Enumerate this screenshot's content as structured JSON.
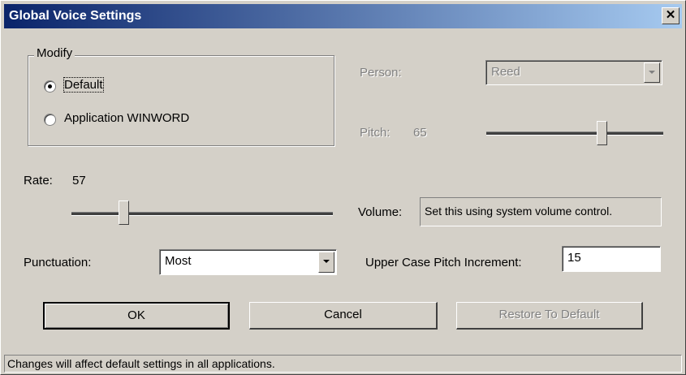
{
  "window": {
    "title": "Global Voice Settings",
    "close_glyph": "✕"
  },
  "modify": {
    "legend": "Modify",
    "options": [
      {
        "label": "Default",
        "selected": true
      },
      {
        "label": "Application WINWORD",
        "selected": false
      }
    ]
  },
  "person": {
    "label": "Person:",
    "value": "Reed",
    "enabled": false
  },
  "pitch": {
    "label": "Pitch:",
    "value": "65",
    "enabled": false,
    "level": 0.65
  },
  "rate": {
    "label": "Rate:",
    "value": "57",
    "level": 0.2
  },
  "volume": {
    "label": "Volume:",
    "value": "Set this using system volume control."
  },
  "punctuation": {
    "label": "Punctuation:",
    "value": "Most"
  },
  "upper_case": {
    "label": "Upper Case Pitch Increment:",
    "value": "15"
  },
  "buttons": {
    "ok": "OK",
    "cancel": "Cancel",
    "restore": "Restore To Default"
  },
  "status": {
    "text": "Changes will affect default settings in all applications."
  },
  "colors": {
    "title_bar_start": "#0a246a",
    "title_bar_end": "#a6caf0",
    "dialog_bg": "#d4d0c8",
    "disabled_text": "#808080"
  }
}
